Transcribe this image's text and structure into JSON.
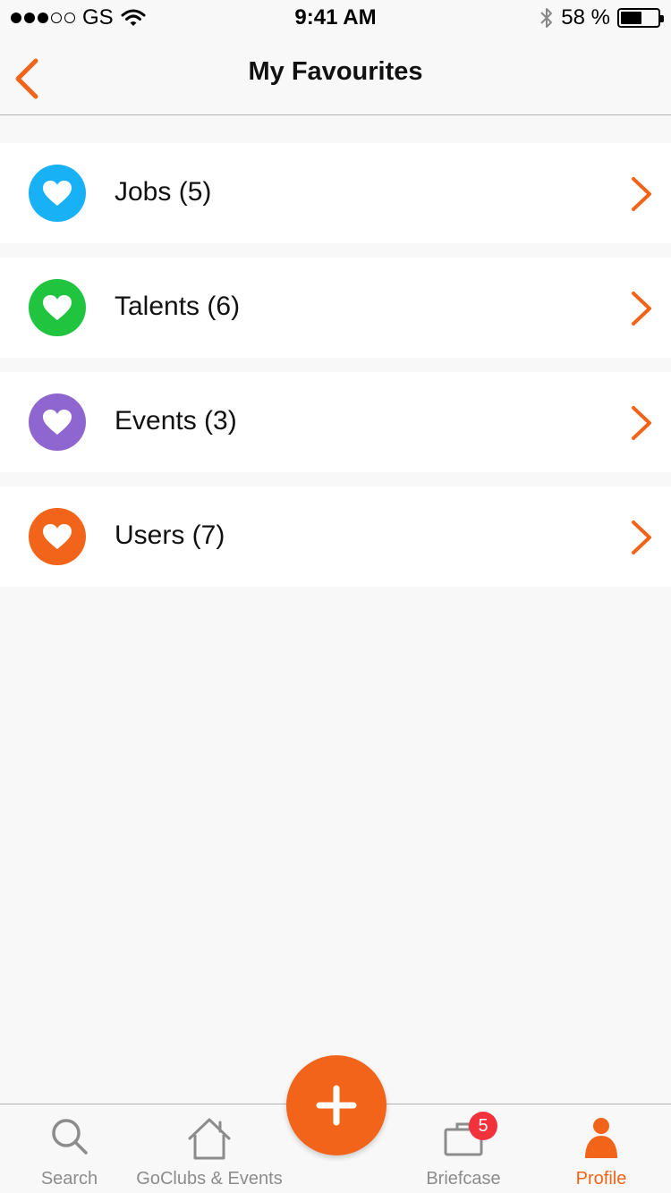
{
  "status_bar": {
    "carrier": "GS",
    "time": "9:41 AM",
    "battery_text": "58 %",
    "battery_level": 0.58
  },
  "nav": {
    "title": "My Favourites"
  },
  "items": [
    {
      "label": "Jobs (5)",
      "color": "#18b1f5",
      "icon": "heart-icon"
    },
    {
      "label": "Talents (6)",
      "color": "#20c43f",
      "icon": "heart-icon"
    },
    {
      "label": "Events (3)",
      "color": "#8f65d0",
      "icon": "heart-icon"
    },
    {
      "label": "Users (7)",
      "color": "#f26419",
      "icon": "heart-icon"
    }
  ],
  "tabs": {
    "search": "Search",
    "goclubs": "GoClubs & Events",
    "briefcase": "Briefcase",
    "briefcase_badge": "5",
    "profile": "Profile"
  },
  "colors": {
    "accent": "#f26419",
    "inactive": "#8c8c8c",
    "badge": "#f1323d"
  }
}
